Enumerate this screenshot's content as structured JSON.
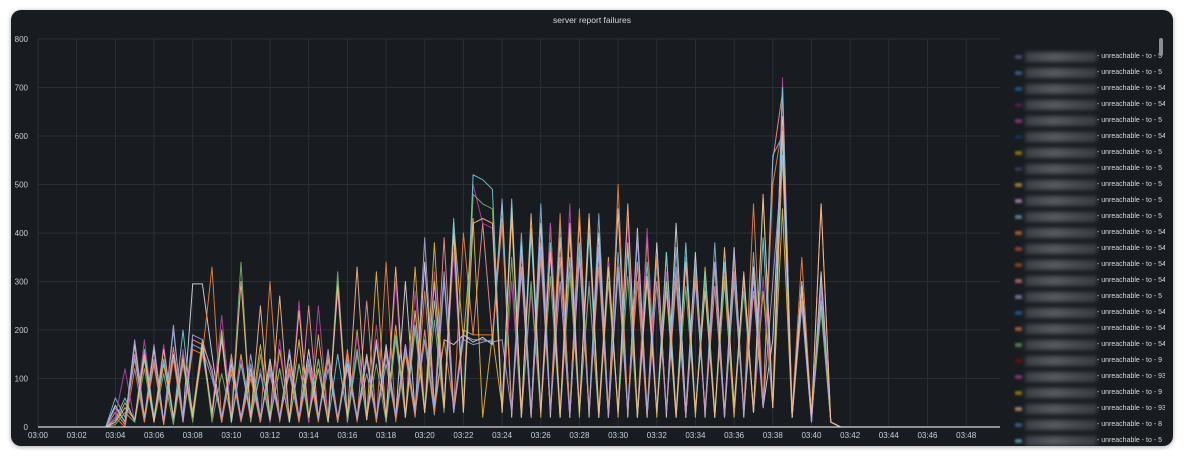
{
  "chart_data": {
    "type": "line",
    "title": "server report failures",
    "ylim": [
      0,
      800
    ],
    "xlim": [
      "03:00:00",
      "03:49:45"
    ],
    "yticks": [
      0,
      100,
      200,
      300,
      400,
      500,
      600,
      700,
      800
    ],
    "xticks": [
      "03:00",
      "03:02",
      "03:04",
      "03:06",
      "03:08",
      "03:10",
      "03:12",
      "03:14",
      "03:16",
      "03:18",
      "03:20",
      "03:22",
      "03:24",
      "03:26",
      "03:28",
      "03:30",
      "03:32",
      "03:34",
      "03:36",
      "03:38",
      "03:40",
      "03:42",
      "03:44",
      "03:46",
      "03:48"
    ],
    "grid": true,
    "legend_placement": "right",
    "x": [
      "03:03:30",
      "03:04:00",
      "03:04:30",
      "03:05:00",
      "03:05:30",
      "03:06:00",
      "03:06:30",
      "03:07:00",
      "03:07:30",
      "03:08:00",
      "03:08:30",
      "03:09:00",
      "03:09:30",
      "03:10:00",
      "03:10:30",
      "03:11:00",
      "03:11:30",
      "03:12:00",
      "03:12:30",
      "03:13:00",
      "03:13:30",
      "03:14:00",
      "03:14:30",
      "03:15:00",
      "03:15:30",
      "03:16:00",
      "03:16:30",
      "03:17:00",
      "03:17:30",
      "03:18:00",
      "03:18:30",
      "03:19:00",
      "03:19:30",
      "03:20:00",
      "03:20:30",
      "03:21:00",
      "03:21:30",
      "03:22:00",
      "03:22:30",
      "03:23:00",
      "03:23:30",
      "03:24:00",
      "03:24:30",
      "03:25:00",
      "03:25:30",
      "03:26:00",
      "03:26:30",
      "03:27:00",
      "03:27:30",
      "03:28:00",
      "03:28:30",
      "03:29:00",
      "03:29:30",
      "03:30:00",
      "03:30:30",
      "03:31:00",
      "03:31:30",
      "03:32:00",
      "03:32:30",
      "03:33:00",
      "03:33:30",
      "03:34:00",
      "03:34:30",
      "03:35:00",
      "03:35:30",
      "03:36:00",
      "03:36:30",
      "03:37:00",
      "03:37:30",
      "03:38:00",
      "03:38:30",
      "03:39:00",
      "03:39:30",
      "03:40:00",
      "03:40:30",
      "03:41:00",
      "03:41:30"
    ],
    "series": [
      {
        "color": "#DCDCDC",
        "values": [
          0,
          45,
          10,
          170,
          15,
          160,
          10,
          150,
          20,
          295,
          295,
          150,
          10,
          130,
          20,
          120,
          10,
          140,
          20,
          150,
          15,
          160,
          20,
          140,
          10,
          130,
          20,
          150,
          15,
          170,
          20,
          300,
          30,
          340,
          40,
          180,
          170,
          190,
          175,
          185,
          170,
          460,
          20,
          380,
          30,
          420,
          20,
          390,
          30,
          430,
          20,
          400,
          30,
          450,
          20,
          410,
          30,
          380,
          20,
          420,
          30,
          360,
          20,
          340,
          30,
          370,
          20,
          330,
          40,
          180,
          640,
          20,
          290,
          10,
          320,
          10,
          0
        ]
      },
      {
        "color": "#F29191",
        "values": [
          0,
          30,
          5,
          150,
          10,
          140,
          5,
          165,
          15,
          180,
          170,
          120,
          10,
          150,
          15,
          110,
          10,
          130,
          15,
          120,
          10,
          250,
          15,
          140,
          10,
          150,
          15,
          260,
          10,
          160,
          20,
          170,
          25,
          200,
          30,
          390,
          40,
          200,
          190,
          420,
          180,
          430,
          30,
          360,
          20,
          380,
          30,
          350,
          20,
          360,
          30,
          370,
          20,
          330,
          30,
          340,
          20,
          350,
          30,
          300,
          20,
          310,
          30,
          290,
          20,
          320,
          30,
          280,
          40,
          550,
          690,
          30,
          300,
          20,
          260,
          10,
          0
        ]
      },
      {
        "color": "#82B5D8",
        "values": [
          0,
          60,
          20,
          140,
          20,
          130,
          10,
          200,
          20,
          170,
          160,
          100,
          20,
          110,
          20,
          130,
          15,
          120,
          20,
          110,
          15,
          130,
          20,
          120,
          15,
          140,
          20,
          110,
          20,
          130,
          20,
          160,
          30,
          180,
          25,
          300,
          30,
          180,
          170,
          175,
          180,
          470,
          30,
          400,
          20,
          460,
          30,
          420,
          20,
          380,
          30,
          440,
          20,
          360,
          30,
          390,
          20,
          350,
          30,
          370,
          20,
          340,
          30,
          380,
          20,
          300,
          30,
          360,
          40,
          560,
          600,
          20,
          250,
          10,
          280,
          10,
          0
        ]
      },
      {
        "color": "#EF843C",
        "values": [
          0,
          20,
          0,
          120,
          10,
          130,
          5,
          140,
          10,
          160,
          150,
          330,
          10,
          120,
          10,
          100,
          10,
          300,
          10,
          130,
          10,
          120,
          10,
          150,
          10,
          160,
          10,
          140,
          10,
          340,
          10,
          150,
          20,
          280,
          30,
          180,
          40,
          400,
          190,
          190,
          190,
          420,
          30,
          320,
          20,
          350,
          30,
          440,
          20,
          450,
          30,
          330,
          20,
          500,
          30,
          300,
          20,
          350,
          30,
          310,
          20,
          320,
          30,
          330,
          20,
          350,
          30,
          460,
          40,
          500,
          620,
          30,
          350,
          20,
          460,
          10,
          0
        ]
      },
      {
        "color": "#EAB839",
        "values": [
          0,
          10,
          50,
          15,
          140,
          10,
          130,
          20,
          150,
          30,
          180,
          20,
          200,
          10,
          150,
          20,
          170,
          10,
          160,
          20,
          180,
          10,
          190,
          20,
          300,
          10,
          200,
          20,
          320,
          10,
          210,
          20,
          330,
          30,
          380,
          40,
          420,
          180,
          430,
          20,
          190,
          40,
          430,
          30,
          410,
          20,
          420,
          30,
          400,
          20,
          430,
          30,
          350,
          20,
          380,
          30,
          390,
          20,
          360,
          30,
          350,
          20,
          330,
          30,
          300,
          20,
          310,
          30,
          280,
          40,
          450,
          20,
          300,
          20,
          250,
          10,
          0
        ]
      },
      {
        "color": "#BA43A9",
        "values": [
          0,
          20,
          120,
          10,
          180,
          15,
          170,
          10,
          160,
          20,
          150,
          30,
          230,
          20,
          140,
          10,
          120,
          10,
          180,
          10,
          260,
          10,
          250,
          20,
          280,
          10,
          190,
          15,
          210,
          20,
          300,
          20,
          280,
          30,
          320,
          40,
          360,
          30,
          500,
          420,
          410,
          30,
          300,
          20,
          280,
          30,
          420,
          20,
          460,
          30,
          300,
          20,
          340,
          30,
          430,
          20,
          410,
          30,
          320,
          20,
          350,
          30,
          300,
          20,
          330,
          40,
          300,
          30,
          310,
          40,
          720,
          20,
          300,
          10,
          280,
          10,
          0
        ]
      },
      {
        "color": "#6ED0E0",
        "values": [
          0,
          15,
          60,
          10,
          160,
          20,
          140,
          15,
          200,
          20,
          160,
          25,
          190,
          10,
          130,
          20,
          110,
          15,
          120,
          10,
          130,
          20,
          140,
          10,
          150,
          20,
          160,
          15,
          170,
          20,
          190,
          25,
          210,
          30,
          260,
          40,
          430,
          30,
          520,
          510,
          490,
          30,
          470,
          20,
          400,
          30,
          380,
          20,
          350,
          30,
          400,
          20,
          330,
          30,
          370,
          20,
          340,
          30,
          360,
          20,
          380,
          30,
          320,
          20,
          340,
          40,
          310,
          30,
          390,
          40,
          700,
          20,
          300,
          20,
          260,
          10,
          0
        ]
      },
      {
        "color": "#7EB26D",
        "values": [
          0,
          5,
          30,
          10,
          120,
          10,
          110,
          5,
          130,
          10,
          170,
          10,
          110,
          20,
          340,
          10,
          150,
          20,
          120,
          10,
          130,
          20,
          140,
          10,
          320,
          10,
          150,
          20,
          130,
          10,
          180,
          20,
          200,
          30,
          220,
          30,
          400,
          40,
          480,
          460,
          450,
          30,
          350,
          20,
          300,
          30,
          310,
          20,
          320,
          30,
          290,
          20,
          300,
          30,
          310,
          20,
          300,
          30,
          280,
          20,
          290,
          30,
          300,
          20,
          310,
          40,
          280,
          30,
          470,
          40,
          560,
          20,
          280,
          20,
          240,
          10,
          0
        ]
      },
      {
        "color": "#AEA2E0",
        "values": [
          0,
          40,
          10,
          180,
          20,
          170,
          10,
          210,
          10,
          190,
          180,
          110,
          20,
          140,
          15,
          150,
          20,
          110,
          15,
          160,
          20,
          140,
          15,
          160,
          20,
          120,
          15,
          140,
          20,
          150,
          20,
          170,
          30,
          390,
          40,
          320,
          30,
          190,
          180,
          180,
          175,
          180,
          30,
          330,
          20,
          370,
          30,
          300,
          20,
          350,
          30,
          360,
          20,
          320,
          30,
          400,
          20,
          300,
          30,
          330,
          20,
          300,
          30,
          340,
          20,
          360,
          30,
          310,
          40,
          300,
          560,
          20,
          260,
          10,
          300,
          10,
          0
        ]
      },
      {
        "color": "#F9BA8F",
        "values": [
          0,
          10,
          40,
          15,
          150,
          10,
          160,
          20,
          140,
          20,
          170,
          30,
          180,
          10,
          300,
          20,
          250,
          15,
          270,
          10,
          240,
          20,
          120,
          10,
          290,
          20,
          330,
          15,
          180,
          20,
          330,
          20,
          240,
          30,
          300,
          40,
          400,
          30,
          420,
          430,
          420,
          30,
          450,
          20,
          440,
          30,
          360,
          20,
          420,
          30,
          440,
          20,
          330,
          30,
          460,
          20,
          310,
          30,
          300,
          20,
          340,
          30,
          280,
          20,
          370,
          40,
          320,
          30,
          480,
          40,
          610,
          20,
          290,
          20,
          460,
          10,
          0
        ]
      }
    ]
  },
  "legend": {
    "items": [
      {
        "label": "- unreachable - to - 5",
        "color": "#705DA0"
      },
      {
        "label": "- unreachable - to - 5",
        "color": "#447EBC"
      },
      {
        "label": "- unreachable - to - 54",
        "color": "#1F78C1"
      },
      {
        "label": "- unreachable - to - 54",
        "color": "#6D1F62"
      },
      {
        "label": "- unreachable - to - 5",
        "color": "#BA43A9"
      },
      {
        "label": "- unreachable - to - 54",
        "color": "#0A437C"
      },
      {
        "label": "- unreachable - to - 5",
        "color": "#CCA300"
      },
      {
        "label": "- unreachable - to - 5",
        "color": "#584477"
      },
      {
        "label": "- unreachable - to - 5",
        "color": "#EAB839"
      },
      {
        "label": "- unreachable - to - 5",
        "color": "#E5A8E2"
      },
      {
        "label": "- unreachable - to - 5",
        "color": "#82B5D8"
      },
      {
        "label": "- unreachable - to - 54",
        "color": "#EF843C"
      },
      {
        "label": "- unreachable - to - 54",
        "color": "#E24D42"
      },
      {
        "label": "- unreachable - to - 54",
        "color": "#C15C17"
      },
      {
        "label": "- unreachable - to - 54",
        "color": "#F29191"
      },
      {
        "label": "- unreachable - to - 5",
        "color": "#AEA2E0"
      },
      {
        "label": "- unreachable - to - 54",
        "color": "#1F78C1"
      },
      {
        "label": "- unreachable - to - 54",
        "color": "#EF843C"
      },
      {
        "label": "- unreachable - to - 54",
        "color": "#7EB26D"
      },
      {
        "label": "- unreachable - to - 9",
        "color": "#890F02"
      },
      {
        "label": "- unreachable - to - 93",
        "color": "#BA43A9"
      },
      {
        "label": "- unreachable - to - 9",
        "color": "#CCA300"
      },
      {
        "label": "- unreachable - to - 93",
        "color": "#F9BA8F"
      },
      {
        "label": "- unreachable - to - 8",
        "color": "#447EBC"
      },
      {
        "label": "- unreachable - to - 5",
        "color": "#6ED0E0"
      }
    ]
  }
}
